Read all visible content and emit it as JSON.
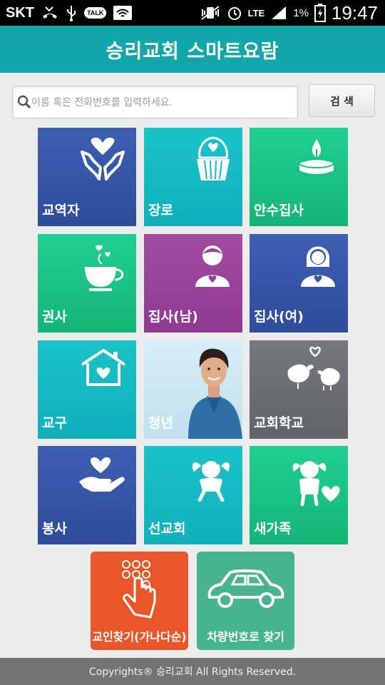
{
  "status_bar": {
    "carrier": "SKT",
    "network": "LTE",
    "battery": "1%",
    "time": "19:47",
    "talk_badge": "TALK"
  },
  "header": {
    "title": "승리교회 스마트요람"
  },
  "search": {
    "placeholder": "이름 혹은 전화번호를 입력하세요.",
    "value": "",
    "button_label": "검 색"
  },
  "tiles": [
    {
      "label": "교역자",
      "icon": "hands-heart-icon",
      "color": "#3556a8"
    },
    {
      "label": "장로",
      "icon": "cupcake-heart-icon",
      "color": "#14b8c0"
    },
    {
      "label": "안수집사",
      "icon": "candle-icon",
      "color": "#1cc286"
    },
    {
      "label": "권사",
      "icon": "teacup-hearts-icon",
      "color": "#1cc286"
    },
    {
      "label": "집사(남)",
      "icon": "man-heart-icon",
      "color": "#99449a"
    },
    {
      "label": "집사(여)",
      "icon": "woman-heart-icon",
      "color": "#3556a8"
    },
    {
      "label": "교구",
      "icon": "house-heart-icon",
      "color": "#14b8c0"
    },
    {
      "label": "청년",
      "icon": "young-man-photo",
      "color": "#cbe7f3"
    },
    {
      "label": "교회학교",
      "icon": "birds-heart-icon",
      "color": "#6a6d71"
    },
    {
      "label": "봉사",
      "icon": "hand-heart-icon",
      "color": "#3556a8"
    },
    {
      "label": "선교회",
      "icon": "cupid-icon",
      "color": "#14b8c0"
    },
    {
      "label": "새가족",
      "icon": "angel-heart-icon",
      "color": "#1cc286"
    }
  ],
  "big_buttons": [
    {
      "label": "교인찾기(가나다순)",
      "icon": "finger-keypad-icon",
      "color": "#e8562a"
    },
    {
      "label": "차량번호로 찾기",
      "icon": "car-icon",
      "color": "#46b48c"
    }
  ],
  "footer": {
    "copyright": "Copyrights® 승리교회 All Rights Reserved."
  }
}
